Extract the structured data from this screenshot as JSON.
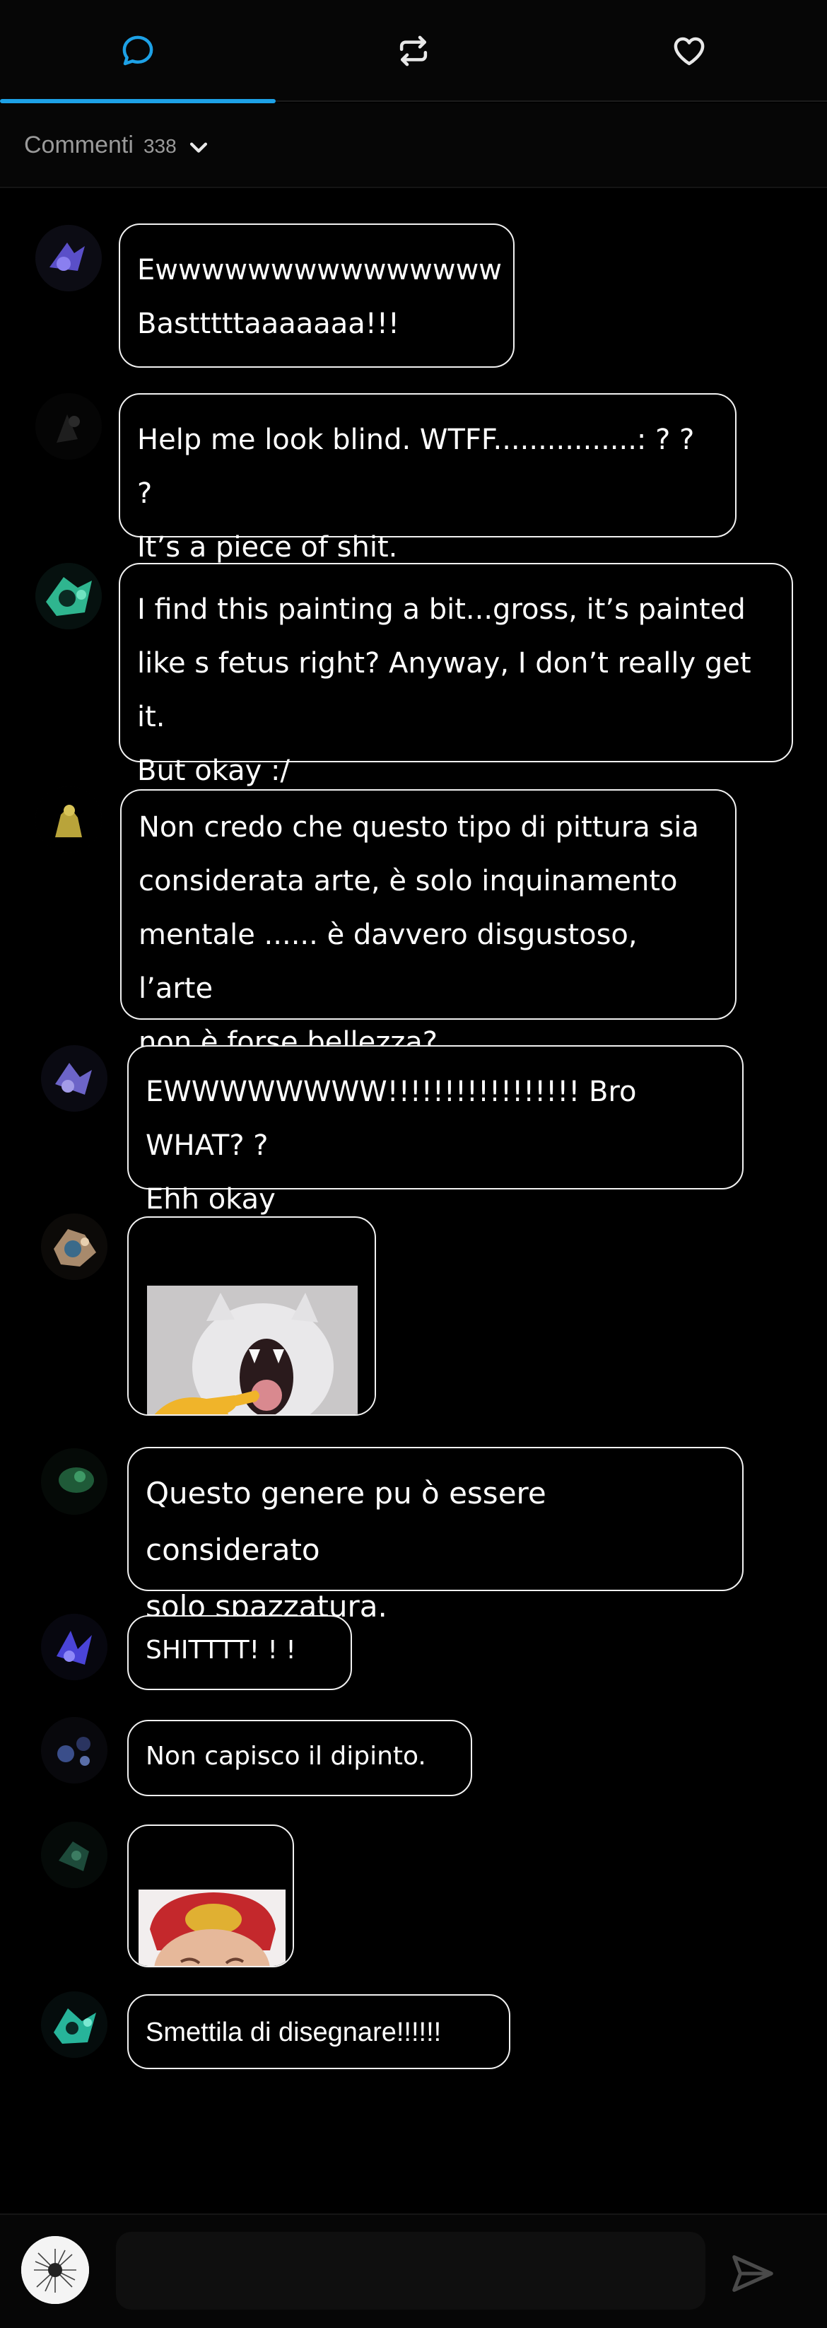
{
  "tabs": [
    {
      "icon": "comment-icon",
      "active": true
    },
    {
      "icon": "repost-icon",
      "active": false
    },
    {
      "icon": "heart-icon",
      "active": false
    }
  ],
  "comments_header": {
    "label": "Commenti",
    "count": "338"
  },
  "comments": [
    {
      "text": "Ewwwwwwwwwwwwwww\nBastttttaaaaaaa!!!"
    },
    {
      "text": "Help me look blind. WTFF................:  ?  ?  ?\nIt’s a piece of shit."
    },
    {
      "text": "I find this painting a bit...gross, it’s painted\nlike s fetus right? Anyway, I don’t really get it.\nBut okay :/"
    },
    {
      "text": "Non credo che questo tipo di pittura sia\nconsiderata arte,  è  solo inquinamento\nmentale ......  è davvero disgustoso, l’arte\nnon  è  forse bellezza?"
    },
    {
      "text": "EWWWWWWWW!!!!!!!!!!!!!!!!!    Bro WHAT?  ?\nEhh okay"
    },
    {
      "text": "",
      "image": "screaming-cat-pointing-sticker"
    },
    {
      "text": "Questo genere pu ò  essere considerato\nsolo spazzatura."
    },
    {
      "text": "SHITTTT!  !  !"
    },
    {
      "text": "Non capisco il dipinto."
    },
    {
      "text": "",
      "image": "clay-figure-sticker"
    },
    {
      "text": "Smettila di disegnare!!!!!!"
    }
  ],
  "input": {
    "placeholder": ""
  },
  "colors": {
    "accent": "#1da1e6",
    "background": "#000000",
    "bubble_border": "#f1f1f1"
  }
}
